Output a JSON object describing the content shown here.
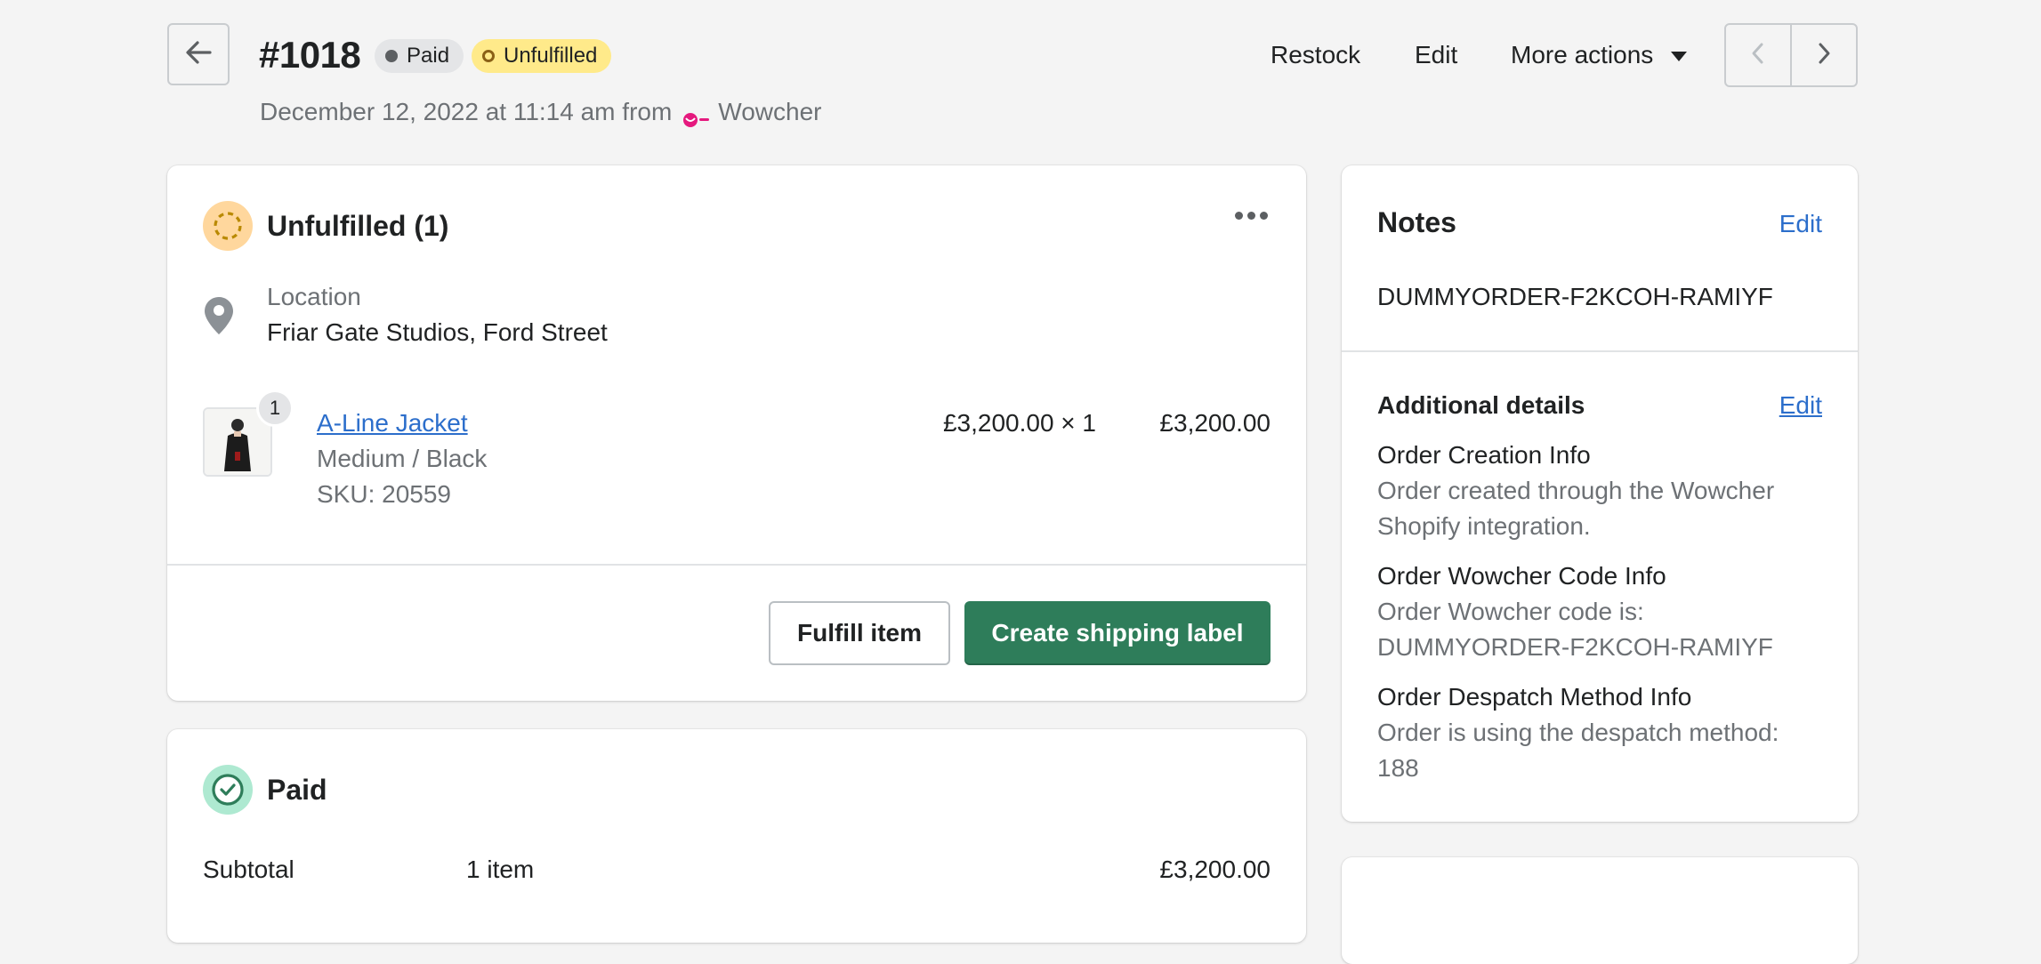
{
  "header": {
    "order_number": "#1018",
    "badges": {
      "payment": "Paid",
      "fulfillment": "Unfulfilled"
    },
    "actions": {
      "restock": "Restock",
      "edit": "Edit",
      "more": "More actions"
    },
    "subtitle": {
      "date_text": "December 12, 2022 at 11:14 am from",
      "channel": "Wowcher"
    }
  },
  "fulfillment_card": {
    "title": "Unfulfilled (1)",
    "location_label": "Location",
    "location_value": "Friar Gate Studios, Ford Street",
    "line_item": {
      "quantity_badge": "1",
      "name": "A-Line Jacket",
      "variant": "Medium / Black",
      "sku": "SKU: 20559",
      "unit_price": "£3,200.00 × 1",
      "total": "£3,200.00"
    },
    "buttons": {
      "fulfill": "Fulfill item",
      "ship": "Create shipping label"
    }
  },
  "payment_card": {
    "title": "Paid",
    "subtotal_label": "Subtotal",
    "subtotal_count": "1 item",
    "subtotal_amount": "£3,200.00"
  },
  "notes_card": {
    "title": "Notes",
    "edit": "Edit",
    "note": "DUMMYORDER-F2KCOH-RAMIYF",
    "additional": {
      "title": "Additional details",
      "edit": "Edit",
      "items": [
        {
          "heading": "Order Creation Info",
          "detail": "Order created through the Wowcher Shopify integration."
        },
        {
          "heading": "Order Wowcher Code Info",
          "detail": "Order Wowcher code is: DUMMYORDER-F2KCOH-RAMIYF"
        },
        {
          "heading": "Order Despatch Method Info",
          "detail": "Order is using the despatch method: 188"
        }
      ]
    }
  },
  "colors": {
    "background": "#f4f4f4",
    "primary_button": "#2e7d5a",
    "link": "#2c6ecb",
    "unfulfilled_badge": "#ffea8a",
    "paid_badge": "#e4e5e7",
    "unfulfilled_icon_bg": "#ffd79d",
    "paid_icon_bg": "#aee9d1"
  },
  "icons": {
    "back": "arrow-left-icon",
    "prev": "chevron-left-icon",
    "next": "chevron-right-icon",
    "more": "horizontal-dots-icon",
    "location": "map-pin-icon",
    "unfulfilled": "dashed-circle-icon",
    "paid": "check-circle-icon",
    "channel": "wowcher-logo-icon"
  }
}
